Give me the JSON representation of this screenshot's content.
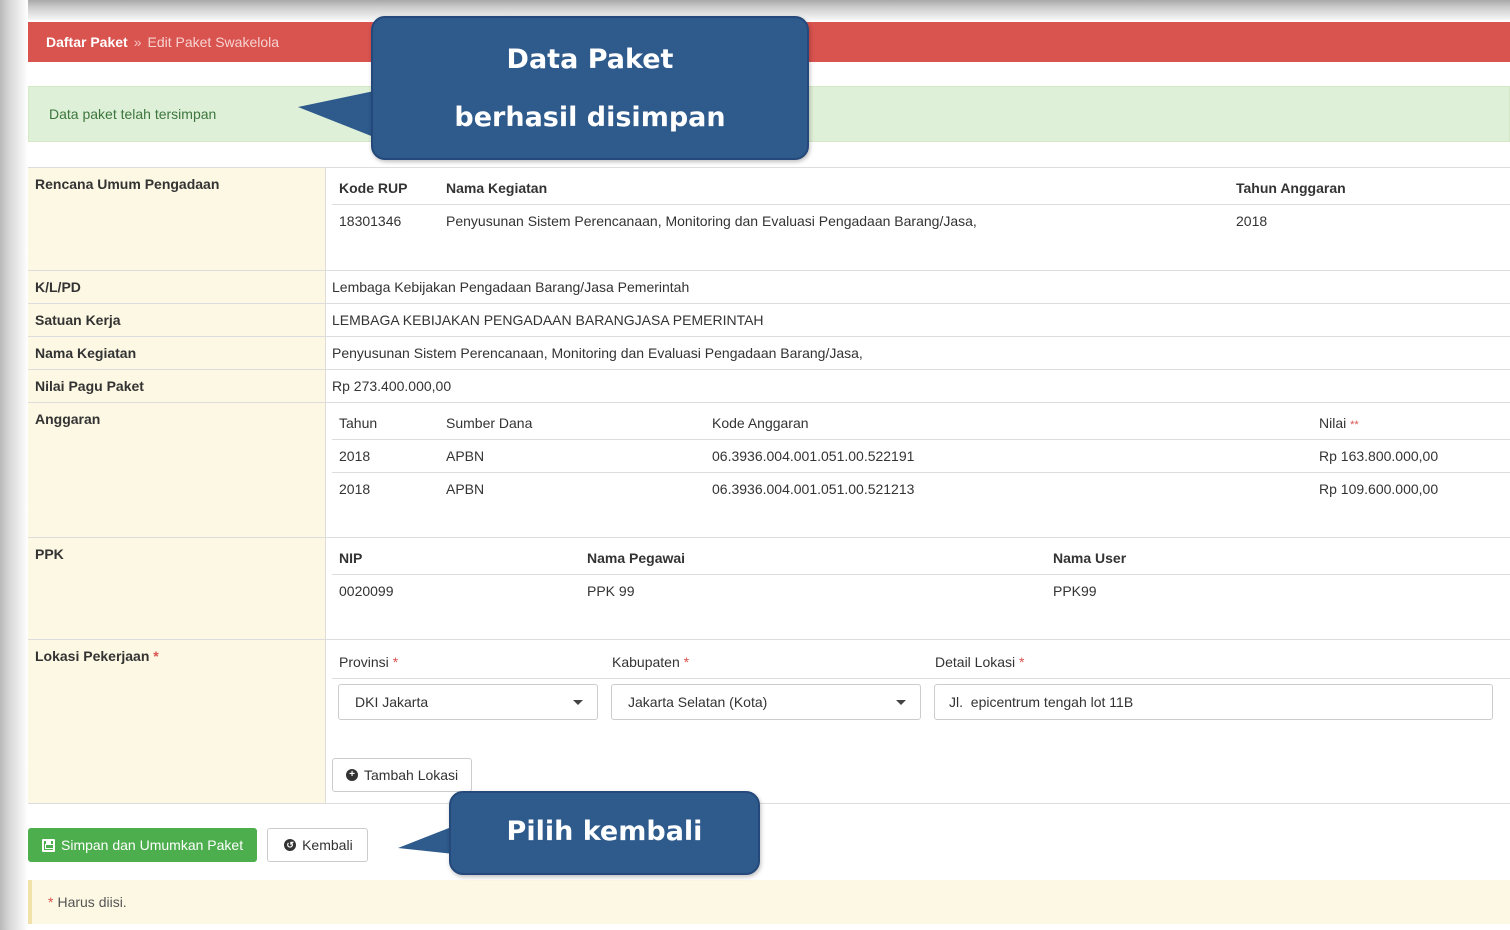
{
  "breadcrumb": {
    "root": "Daftar Paket",
    "separator": "»",
    "current": "Edit Paket Swakelola"
  },
  "alert": {
    "message": "Data paket telah tersimpan"
  },
  "rup": {
    "label": "Rencana Umum Pengadaan",
    "headers": [
      "Kode RUP",
      "Nama Kegiatan",
      "Tahun Anggaran"
    ],
    "row": [
      "18301346",
      "Penyusunan Sistem Perencanaan, Monitoring dan Evaluasi Pengadaan Barang/Jasa,",
      "2018"
    ]
  },
  "klpd": {
    "label": "K/L/PD",
    "value": "Lembaga Kebijakan Pengadaan Barang/Jasa Pemerintah"
  },
  "satuan_kerja": {
    "label": "Satuan Kerja",
    "value": "LEMBAGA KEBIJAKAN PENGADAAN BARANGJASA PEMERINTAH"
  },
  "nama_kegiatan": {
    "label": "Nama Kegiatan",
    "value": "Penyusunan Sistem Perencanaan, Monitoring dan Evaluasi Pengadaan Barang/Jasa,"
  },
  "nilai_pagu": {
    "label": "Nilai Pagu Paket",
    "value": "Rp 273.400.000,00"
  },
  "anggaran": {
    "label": "Anggaran",
    "headers": [
      "Tahun",
      "Sumber Dana",
      "Kode Anggaran",
      "Nilai"
    ],
    "nilai_marker": "**",
    "rows": [
      [
        "2018",
        "APBN",
        "06.3936.004.001.051.00.522191",
        "Rp 163.800.000,00"
      ],
      [
        "2018",
        "APBN",
        "06.3936.004.001.051.00.521213",
        "Rp 109.600.000,00"
      ]
    ]
  },
  "ppk": {
    "label": "PPK",
    "headers": [
      "NIP",
      "Nama Pegawai",
      "Nama User"
    ],
    "row": [
      "0020099",
      "PPK 99",
      "PPK99"
    ]
  },
  "lokasi": {
    "label": "Lokasi Pekerjaan",
    "required_marker": "*",
    "provinsi_label": "Provinsi",
    "kabupaten_label": "Kabupaten",
    "detail_label": "Detail Lokasi",
    "provinsi_value": "DKI Jakarta",
    "kabupaten_value": "Jakarta Selatan (Kota)",
    "detail_value": "Jl.  epicentrum tengah lot 11B",
    "add_button": "Tambah Lokasi"
  },
  "actions": {
    "save_label": "Simpan dan Umumkan Paket",
    "back_label": "Kembali"
  },
  "note": {
    "marker": "*",
    "text": "Harus diisi."
  },
  "callouts": {
    "top": "Data Paket berhasil disimpan",
    "bottom": "Pilih kembali"
  },
  "colors": {
    "breadcrumb_bg": "#d9534f",
    "alert_bg": "#dff0d8",
    "label_bg": "#fcf8e3",
    "success": "#4cae4c",
    "callout_bg": "#2e5a8c"
  }
}
